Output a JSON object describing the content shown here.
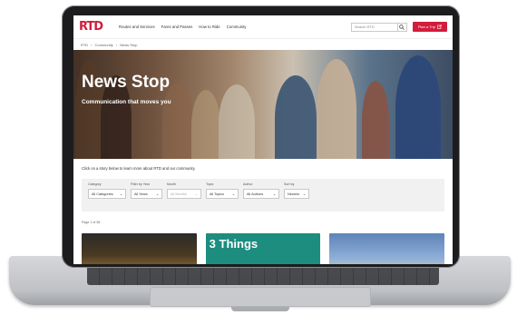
{
  "header": {
    "logo": "RTD",
    "nav": [
      "Routes and Services",
      "Fares and Passes",
      "How to Ride",
      "Community"
    ],
    "search_placeholder": "Search RTD",
    "plan_button": "Plan a Trip",
    "search_icon": "magnifier-icon",
    "external_icon": "external-link-icon"
  },
  "breadcrumb": [
    "RTD",
    "Community",
    "News Stop"
  ],
  "hero": {
    "title": "News Stop",
    "subtitle": "Communication that moves you"
  },
  "intro": "Click on a story below to learn more about RTD and our community.",
  "filters": [
    {
      "label": "Category",
      "value": "All Categories",
      "disabled": false
    },
    {
      "label": "Filter by Year",
      "value": "All Years",
      "disabled": false
    },
    {
      "label": "Month",
      "value": "All Months",
      "disabled": true
    },
    {
      "label": "Topic",
      "value": "All Topics",
      "disabled": false
    },
    {
      "label": "Author",
      "value": "All Authors",
      "disabled": false
    },
    {
      "label": "Sort by",
      "value": "Newest",
      "disabled": false
    }
  ],
  "page_info": "Page 1 of 58",
  "cards": [
    {
      "text": ""
    },
    {
      "text": "3 Things"
    },
    {
      "text": ""
    }
  ],
  "colors": {
    "brand": "#d21c3c",
    "card_teal": "#1c8d7f"
  }
}
